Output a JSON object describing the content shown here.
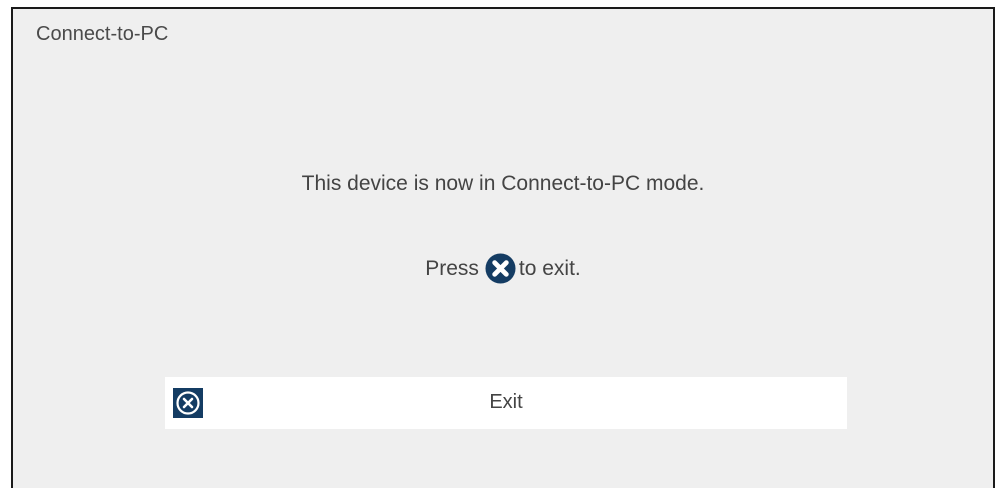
{
  "dialog": {
    "title": "Connect-to-PC",
    "message": "This device is now in Connect-to-PC mode.",
    "press_before": "Press",
    "press_icon": "x-circle-icon",
    "press_after": "to exit."
  },
  "exit_button": {
    "icon": "x-circle-outline-icon",
    "label": "Exit"
  },
  "colors": {
    "background": "#efefef",
    "accent": "#143c63",
    "button_background": "#ffffff",
    "text": "#444444",
    "frame": "#1a1a1a"
  }
}
